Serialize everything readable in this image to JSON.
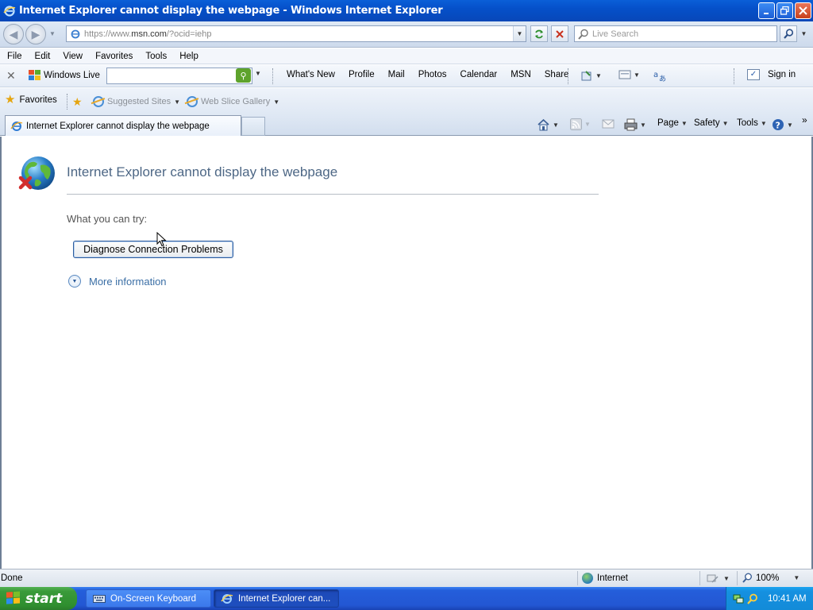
{
  "window": {
    "title": "Internet Explorer cannot display the webpage - Windows Internet Explorer",
    "minimize_icon": "minimize-icon",
    "restore_icon": "restore-icon",
    "close_icon": "close-icon"
  },
  "address_bar": {
    "url_prefix": "https://www.",
    "url_domain": "msn.com",
    "url_suffix": "/?ocid=iehp",
    "search_placeholder": "Live Search"
  },
  "menu": [
    "File",
    "Edit",
    "View",
    "Favorites",
    "Tools",
    "Help"
  ],
  "live_toolbar": {
    "brand": "Windows Live",
    "links": [
      "What's New",
      "Profile",
      "Mail",
      "Photos",
      "Calendar",
      "MSN",
      "Share"
    ],
    "sign_in": "Sign in"
  },
  "favorites_bar": {
    "favorites": "Favorites",
    "suggested_sites": "Suggested Sites",
    "web_slice_gallery": "Web Slice Gallery"
  },
  "tab": {
    "title": "Internet Explorer cannot display the webpage"
  },
  "command_bar": {
    "page": "Page",
    "safety": "Safety",
    "tools": "Tools"
  },
  "content": {
    "heading": "Internet Explorer cannot display the webpage",
    "try_label": "What you can try:",
    "diagnose_button": "Diagnose Connection Problems",
    "more_info": "More information"
  },
  "status_bar": {
    "status": "Done",
    "zone": "Internet",
    "zoom": "100%"
  },
  "taskbar": {
    "start": "start",
    "tasks": [
      "On-Screen Keyboard",
      "Internet Explorer can..."
    ],
    "clock": "10:41 AM"
  },
  "colors": {
    "titlebar": "#0550c9",
    "heading": "#4d6785",
    "link": "#3a6ea5",
    "start_green": "#3a9a3a"
  }
}
